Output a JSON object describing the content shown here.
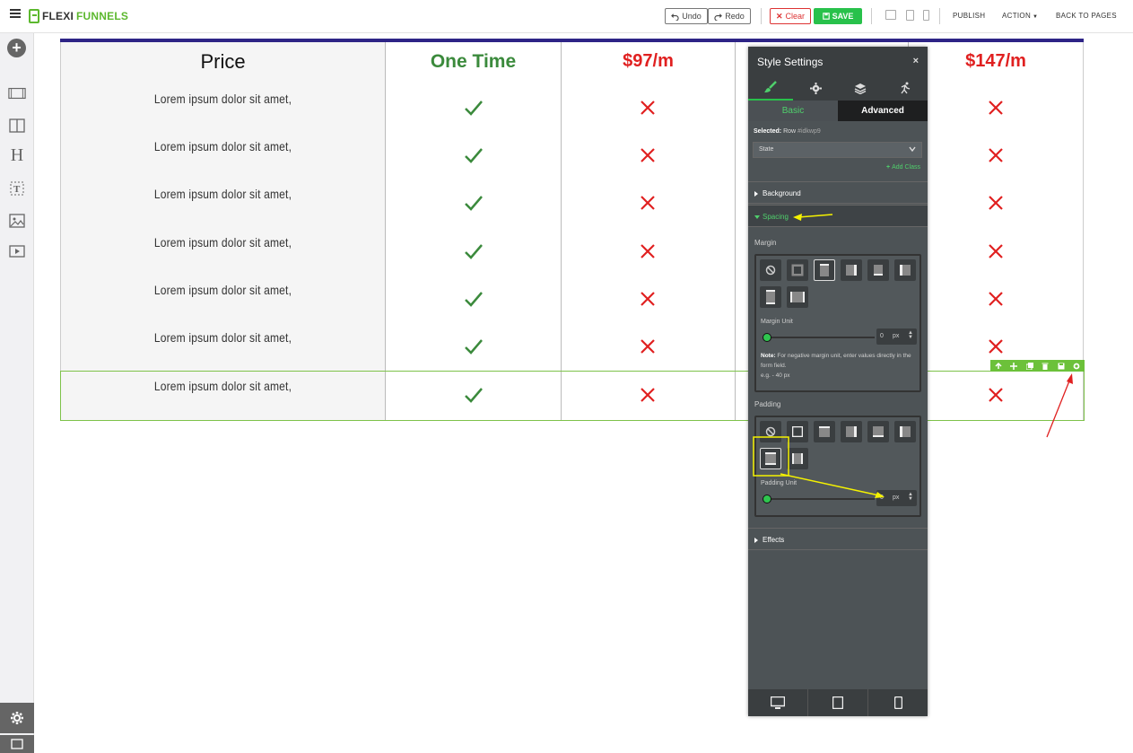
{
  "brand": {
    "name_part1": "FLEXI",
    "name_part2": "FUNNELS",
    "accent_color": "#5cb82e"
  },
  "toolbar": {
    "undo_label": "Undo",
    "redo_label": "Redo",
    "clear_label": "Clear",
    "save_label": "SAVE",
    "publish_label": "PUBLISH",
    "action_label": "ACTION",
    "back_label": "BACK TO PAGES"
  },
  "pricing_table": {
    "header_label": "Price",
    "columns": [
      {
        "label": "One Time",
        "color": "#3b8a3c"
      },
      {
        "label": "$97/m",
        "color": "#e02020"
      },
      {
        "label": "$147/m",
        "color": "#e02020"
      }
    ],
    "features": [
      "Lorem ipsum dolor sit amet,",
      "Lorem ipsum dolor sit amet,",
      "Lorem ipsum dolor sit amet,",
      "Lorem ipsum dolor sit amet,",
      "Lorem ipsum dolor sit amet,",
      "Lorem ipsum dolor sit amet,",
      "Lorem ipsum dolor sit amet,"
    ]
  },
  "style_panel": {
    "title": "Style Settings",
    "close_label": "×",
    "subtabs": {
      "basic": "Basic",
      "advanced": "Advanced"
    },
    "selected_prefix": "Selected:",
    "selected_type": "Row",
    "selected_id": "#idkwp9",
    "state_placeholder": "State",
    "add_class_label": "Add Class",
    "sections": {
      "background": "Background",
      "spacing": "Spacing",
      "effects": "Effects"
    },
    "margin": {
      "label": "Margin",
      "unit_label": "Margin Unit",
      "value": "0",
      "unit": "px",
      "note_bold": "Note:",
      "note_text": "For negative margin unit, enter values directly in the form field.",
      "note_example": "e.g. - 40 px"
    },
    "padding": {
      "label": "Padding",
      "unit_label": "Padding Unit",
      "value": "0",
      "unit": "px"
    }
  },
  "annotation_color": "#f5f200",
  "arrow_color": "#e02020"
}
